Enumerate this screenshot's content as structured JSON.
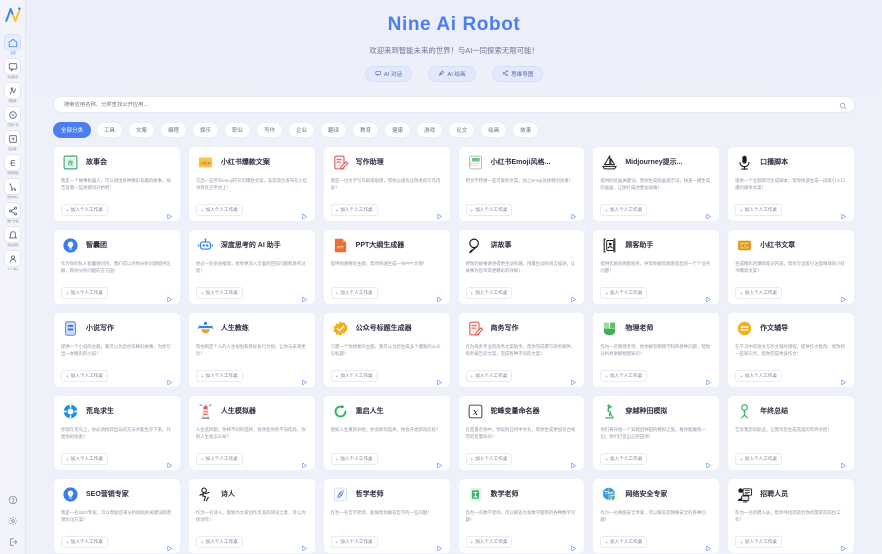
{
  "sidebar": {
    "logo": "nine-ai-logo",
    "items": [
      {
        "label": "主页",
        "icon": "home-icon",
        "active": true
      },
      {
        "label": "对话助手",
        "icon": "chat-icon",
        "active": false
      },
      {
        "label": "智能体",
        "icon": "robot-icon",
        "active": false
      },
      {
        "label": "应用广场",
        "icon": "apps-icon",
        "active": false
      },
      {
        "label": "知识库",
        "icon": "library-icon",
        "active": false
      },
      {
        "label": "思维导图",
        "icon": "mindmap-icon",
        "active": false
      },
      {
        "label": "创作中心",
        "icon": "cart-icon",
        "active": false
      },
      {
        "label": "推广分销",
        "icon": "share-icon",
        "active": false
      },
      {
        "label": "消息通知",
        "icon": "bell-icon",
        "active": false
      },
      {
        "label": "个人中心",
        "icon": "user-icon",
        "active": false
      }
    ],
    "bottom": [
      {
        "label": "帮助",
        "icon": "help-icon"
      },
      {
        "label": "设置",
        "icon": "gear-icon"
      },
      {
        "label": "退出",
        "icon": "logout-icon"
      }
    ]
  },
  "hero": {
    "title": "Nine Ai Robot",
    "subtitle": "欢迎来到智能未来的世界！与AI一同探索无限可能！",
    "chips": [
      {
        "label": "AI 对话",
        "icon": "chat-bubble-icon"
      },
      {
        "label": "AI 绘画",
        "icon": "paint-icon"
      },
      {
        "label": "思维导图",
        "icon": "mindmap-icon"
      }
    ]
  },
  "search": {
    "placeholder": "搜索应用名称、分类查找公开应用...",
    "value": "",
    "icon": "search-icon"
  },
  "tabs": [
    {
      "label": "全部分类",
      "active": true
    },
    {
      "label": "工具",
      "active": false
    },
    {
      "label": "文案",
      "active": false
    },
    {
      "label": "编程",
      "active": false
    },
    {
      "label": "娱乐",
      "active": false
    },
    {
      "label": "职业",
      "active": false
    },
    {
      "label": "写作",
      "active": false
    },
    {
      "label": "企业",
      "active": false
    },
    {
      "label": "翻译",
      "active": false
    },
    {
      "label": "教育",
      "active": false
    },
    {
      "label": "健康",
      "active": false
    },
    {
      "label": "游戏",
      "active": false
    },
    {
      "label": "论文",
      "active": false
    },
    {
      "label": "绘画",
      "active": false
    },
    {
      "label": "故事",
      "active": false
    }
  ],
  "card_common": {
    "add_label": "加入个人工作桌",
    "play_icon": "play-icon",
    "plus_icon": "plus-icon"
  },
  "cards": [
    {
      "title": "故事会",
      "desc": "我是一个故事机器人，可以讲出各种精彩有趣的故事，快告诉我一些关键词开始吧！",
      "icon": "book-green-icon"
    },
    {
      "title": "小红书爆款文案",
      "desc": "写出一些带有emoji符号的爆款文案，非常适合发布在小红书等社交平台上！",
      "icon": "redbook-icon"
    },
    {
      "title": "写作助理",
      "desc": "我是一位文字写作助理助理，帮你公速优化改进的写作内容！",
      "icon": "pen-doc-red-icon"
    },
    {
      "title": "小红书Emoji风格...",
      "desc": "把文字转换一些可爱的文案，加上Emoji风格特别效果！",
      "icon": "note-green-icon"
    },
    {
      "title": "Midjourney提示...",
      "desc": "提供的绘画关键词，帮你生成绘画提示词，快速一键生成的画面，让图片描述更加准确！",
      "icon": "sailboat-icon"
    },
    {
      "title": "口播脚本",
      "desc": "提供一个主题即可生成脚本，帮你快速生成一段吸引人口播的脚本文案！",
      "icon": "microphone-icon"
    },
    {
      "title": "智囊团",
      "desc": "作为你的私人智囊顾问团，我们可以为你分析问题提供正解，帮你分析问题的方方面！",
      "icon": "bulb-blue-icon"
    },
    {
      "title": "深度思考的 AI 助手",
      "desc": "经过一轮多层推理，给你更深入全面的回答问题和思考过程！",
      "icon": "robot-blue-icon"
    },
    {
      "title": "PPT大纲生成器",
      "desc": "提供你想要的主题，帮你快速生成一份PPT大纲！",
      "icon": "ppt-orange-icon"
    },
    {
      "title": "讲故事",
      "desc": "把你的故事讲述得更生动有趣，用最生动的语言描述，让故事为您带来更精彩的效果！",
      "icon": "magnifier-icon"
    },
    {
      "title": "顾客助手",
      "desc": "提供优质的顾客服务，并帮你解答顾客提出的一个个业务问题！",
      "icon": "contact-card-icon"
    },
    {
      "title": "小红书文章",
      "desc": "生成精彩的爆款笔记内容，帮你写出吸引注意眼球的小红书爆款文案！",
      "icon": "redbook-yellow-icon"
    },
    {
      "title": "小说写作",
      "desc": "提供一个小说的主题，我可以为您创作精彩故事，为你写出一本精彩的小说！",
      "icon": "book-blue-icon"
    },
    {
      "title": "人生教练",
      "desc": "帮你制定个人的人生规划和目标执行计划，让你与未来更近！",
      "icon": "lifecoach-icon"
    },
    {
      "title": "公众号标题生成器",
      "desc": "只需一个你想要的主题，我可以为您生成多个爆款的公众号标题！",
      "icon": "check-gold-icon"
    },
    {
      "title": "商务写作",
      "desc": "作为商务专业的商务文案助手，帮你完成撰写商务邮件、商务报告的文案，完成各种不同的文案！",
      "icon": "pen-doc-red-icon"
    },
    {
      "title": "物理老师",
      "desc": "作为一名物理老师，给你解答物理学科的各种问题，帮你分析并讲解物理知识！",
      "icon": "physics-green-icon"
    },
    {
      "title": "作文辅导",
      "desc": "在学习中的语文写作文辅导课程，提供作文批改、修改和一些知识点，帮你完成更多作文！",
      "icon": "equals-gold-icon"
    },
    {
      "title": "荒岛求生",
      "desc": "你现在荒岛上，你必须找到出岛的方法才能生存下来。开始你的探索！",
      "icon": "lifebuoy-icon"
    },
    {
      "title": "人生模拟器",
      "desc": "人生选择题，你将不同的选择，会改变你的不同结局，你的人生会怎么样？",
      "icon": "lighthouse-icon"
    },
    {
      "title": "重启人生",
      "desc": "假如人生重新开始，你会如何选择，你会开始新的历程？",
      "icon": "refresh-green-icon"
    },
    {
      "title": "驼峰变量命名器",
      "desc": "在变量名称中，你说的任何中文名，帮你生成更加符合规范的变量命名！",
      "icon": "x-variable-icon"
    },
    {
      "title": "穿越种田模拟",
      "desc": "你们将开始一个穿越后种田的模拟之旅，看你能做到一切，你们打造自己的田地！",
      "icon": "farmer-green-icon"
    },
    {
      "title": "年终总结",
      "desc": "告诉我您的职业，让我为您生成完美的年终总结！",
      "icon": "person-green-icon"
    },
    {
      "title": "SEO营销专家",
      "desc": "我是一名SEO专家，可以帮助您来分析网站的关键词和营销优化方案！",
      "icon": "seo-blue-icon"
    },
    {
      "title": "诗人",
      "desc": "作为一名诗人，能够为大家创作优美的诗词之意，可以为你创作！",
      "icon": "poet-icon"
    },
    {
      "title": "哲学老师",
      "desc": "作为一名哲学老师，能够帮你解答哲学的一些问题！",
      "icon": "feather-blue-icon"
    },
    {
      "title": "数学老师",
      "desc": "作为一名数学老师，可以解答大家数学题目的各种数学问题！",
      "icon": "math-green-icon"
    },
    {
      "title": "网络安全专家",
      "desc": "作为一名网络安全专家，可以解答您网络安全的各种问题！",
      "icon": "globe-security-icon"
    },
    {
      "title": "招聘人员",
      "desc": "作为一名招聘人员，帮你寻找到适合你所需求的岗位工作！",
      "icon": "recruiter-icon"
    }
  ]
}
